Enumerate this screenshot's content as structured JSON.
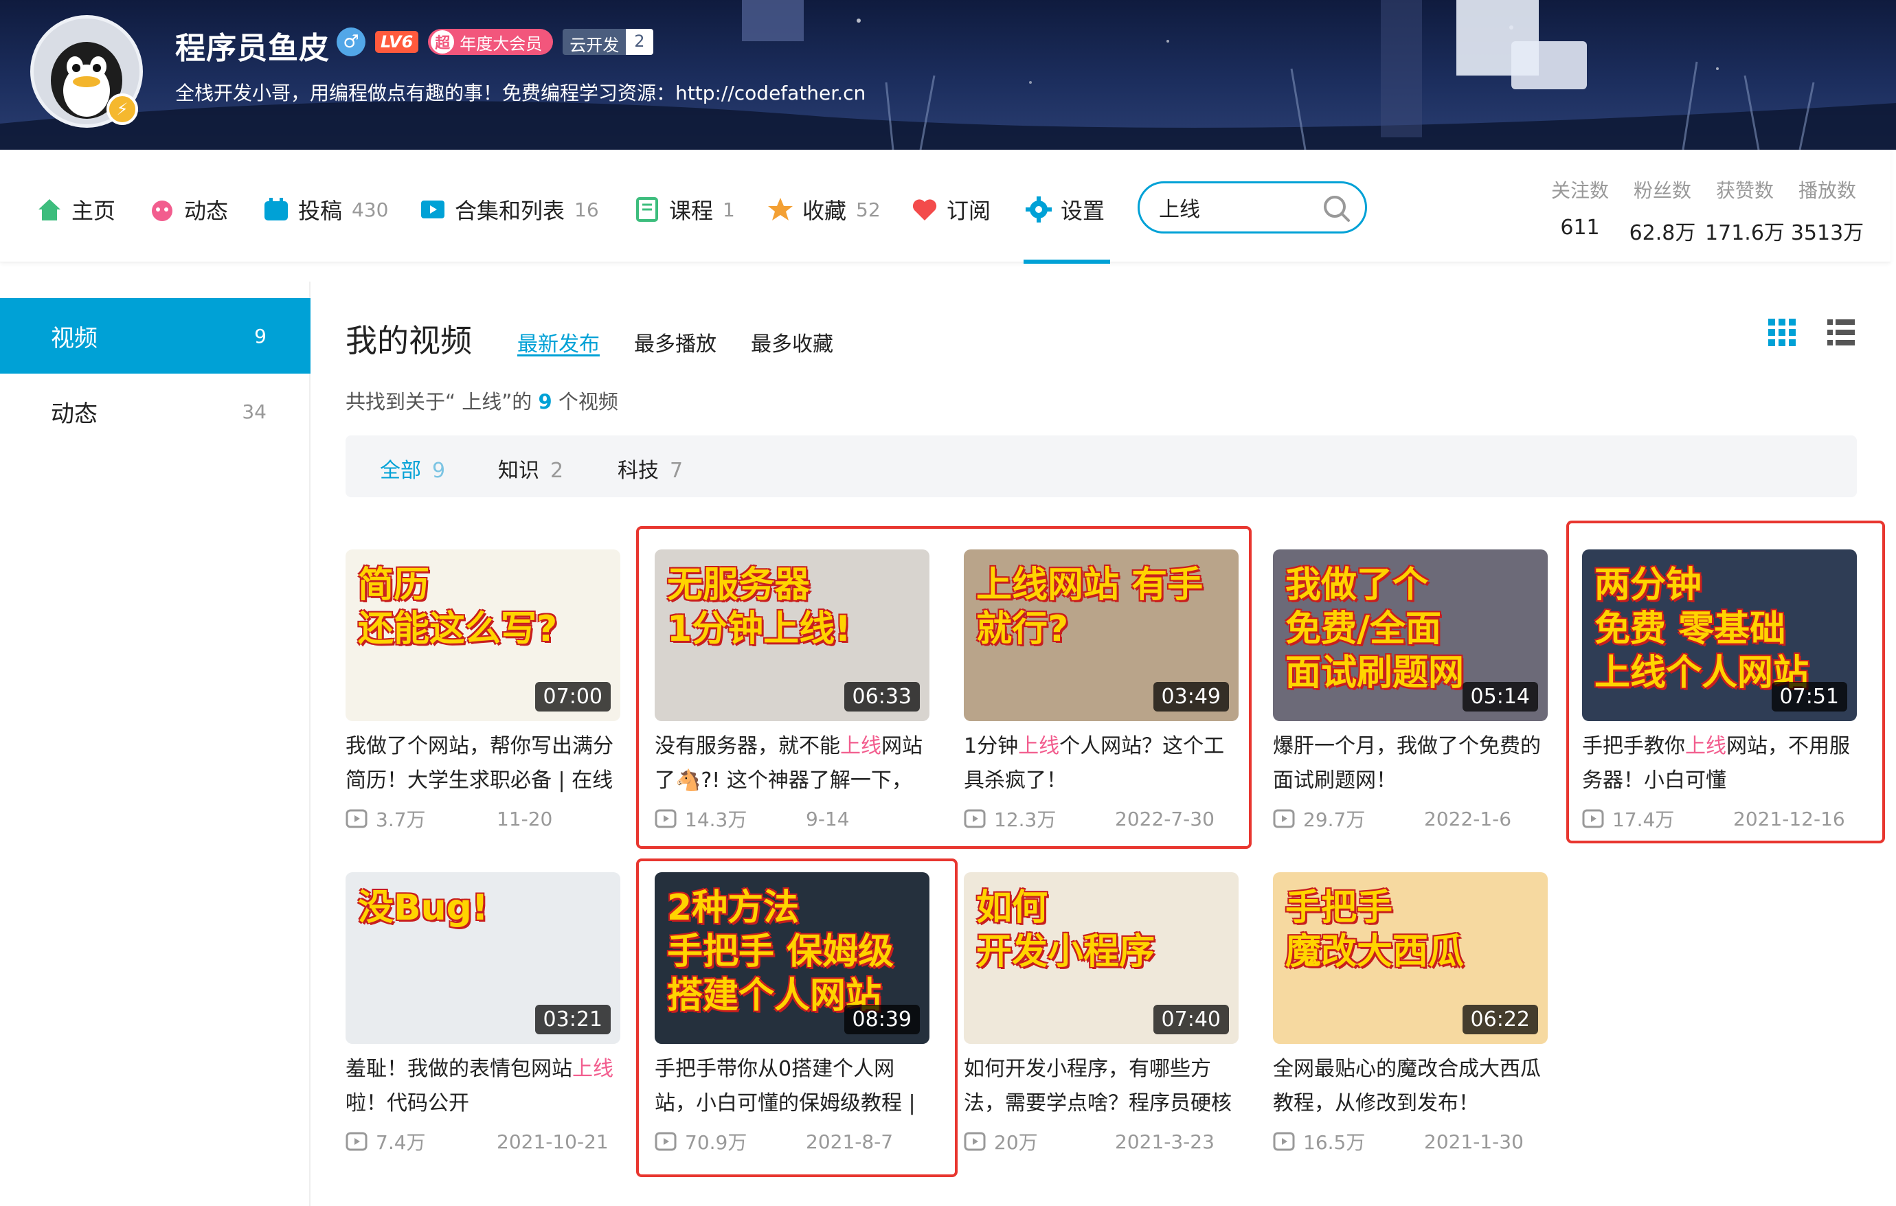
{
  "profile": {
    "name": "程序员鱼皮",
    "level": "LV6",
    "vip_circle": "超",
    "vip_label": "年度大会员",
    "cloud_label": "云开发",
    "cloud_count": "2",
    "sign": "全栈开发小哥，用编程做点有趣的事！免费编程学习资源：http://codefather.cn"
  },
  "nav": {
    "items": [
      {
        "label": "主页",
        "count": "",
        "icon": "home-icon",
        "color": "#3dbd7d"
      },
      {
        "label": "动态",
        "count": "",
        "icon": "dynamic-icon",
        "color": "#f25d8e"
      },
      {
        "label": "投稿",
        "count": "430",
        "icon": "upload-icon",
        "color": "#00a1d6"
      },
      {
        "label": "合集和列表",
        "count": "16",
        "icon": "collection-icon",
        "color": "#00a1d6"
      },
      {
        "label": "课程",
        "count": "1",
        "icon": "course-icon",
        "color": "#3dbd7d"
      },
      {
        "label": "收藏",
        "count": "52",
        "icon": "favorite-icon",
        "color": "#f3a034"
      },
      {
        "label": "订阅",
        "count": "",
        "icon": "subscribe-icon",
        "color": "#f34b4b"
      },
      {
        "label": "设置",
        "count": "",
        "icon": "settings-icon",
        "color": "#00a1d6"
      }
    ],
    "search_value": "上线",
    "stats": [
      {
        "label": "关注数",
        "value": "611"
      },
      {
        "label": "粉丝数",
        "value": "62.8万"
      },
      {
        "label": "获赞数",
        "value": "171.6万"
      },
      {
        "label": "播放数",
        "value": "3513万"
      }
    ]
  },
  "sidebar": {
    "items": [
      {
        "label": "视频",
        "count": "9"
      },
      {
        "label": "动态",
        "count": "34"
      }
    ]
  },
  "main": {
    "title": "我的视频",
    "sorts": [
      "最新发布",
      "最多播放",
      "最多收藏"
    ],
    "found_prefix": "共找到关于“ 上线”的",
    "found_count": "9",
    "found_suffix": "个视频",
    "filters": [
      {
        "label": "全部",
        "count": "9"
      },
      {
        "label": "知识",
        "count": "2"
      },
      {
        "label": "科技",
        "count": "7"
      }
    ]
  },
  "videos": [
    {
      "thumb_text": "简历\n还能这么写?",
      "duration": "07:00",
      "title_a": "我做了个网站，帮你写出满分简历！大学生求职必备 | 在线",
      "title_hl": "",
      "title_b": "",
      "plays": "3.7万",
      "date": "11-20",
      "bg": "#f6f3ea"
    },
    {
      "thumb_text": "无服务器\n1分钟上线!",
      "duration": "06:33",
      "title_a": "没有服务器，就不能",
      "title_hl": "上线",
      "title_b": "网站了🐴?! 这个神器了解一下，",
      "plays": "14.3万",
      "date": "9-14",
      "bg": "#d8d4cf"
    },
    {
      "thumb_text": "上线网站 有手就行?",
      "duration": "03:49",
      "title_a": "1分钟",
      "title_hl": "上线",
      "title_b": "个人网站？这个工具杀疯了！",
      "plays": "12.3万",
      "date": "2022-7-30",
      "bg": "#b9a48a"
    },
    {
      "thumb_text": "我做了个\n免费/全面\n面试刷题网",
      "duration": "05:14",
      "title_a": "爆肝一个月，我做了个免费的面试刷题网！",
      "title_hl": "",
      "title_b": "",
      "plays": "29.7万",
      "date": "2022-1-6",
      "bg": "#6c6a78"
    },
    {
      "thumb_text": "两分钟\n免费 零基础\n上线个人网站",
      "duration": "07:51",
      "title_a": "手把手教你",
      "title_hl": "上线",
      "title_b": "网站，不用服务器！小白可懂",
      "plays": "17.4万",
      "date": "2021-12-16",
      "bg": "#2f3d55"
    },
    {
      "thumb_text": "没Bug!",
      "duration": "03:21",
      "title_a": "羞耻！我做的表情包网站",
      "title_hl": "上线",
      "title_b": "啦！代码公开",
      "plays": "7.4万",
      "date": "2021-10-21",
      "bg": "#e9ecef"
    },
    {
      "thumb_text": "2种方法\n手把手 保姆级\n搭建个人网站",
      "duration": "08:39",
      "title_a": "手把手带你从0搭建个人网站，小白可懂的保姆级教程 |",
      "title_hl": "",
      "title_b": "",
      "plays": "70.9万",
      "date": "2021-8-7",
      "bg": "#25303d"
    },
    {
      "thumb_text": "如何\n开发小程序",
      "duration": "07:40",
      "title_a": "如何开发小程序，有哪些方法，需要学点啥？程序员硬核",
      "title_hl": "",
      "title_b": "",
      "plays": "20万",
      "date": "2021-3-23",
      "bg": "#efe8da"
    },
    {
      "thumb_text": "手把手\n魔改大西瓜",
      "duration": "06:22",
      "title_a": "全网最贴心的魔改合成大西瓜教程，从修改到发布！",
      "title_hl": "",
      "title_b": "",
      "plays": "16.5万",
      "date": "2021-1-30",
      "bg": "#f6d9a0"
    }
  ]
}
